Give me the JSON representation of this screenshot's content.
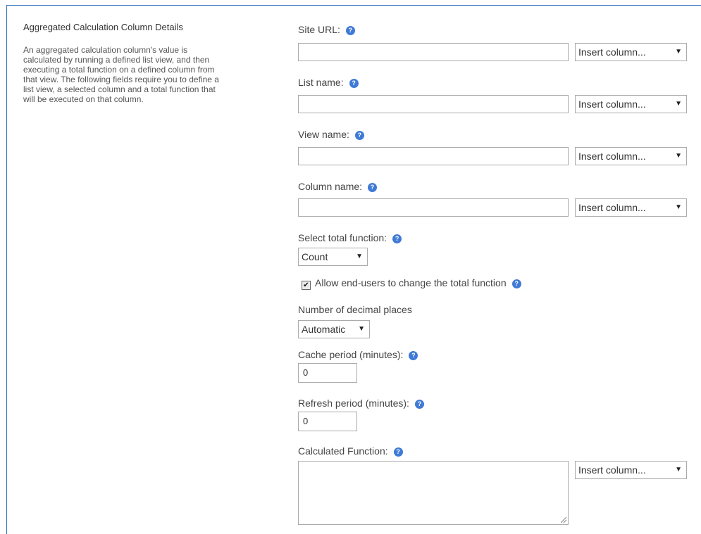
{
  "section": {
    "title": "Aggregated Calculation Column Details",
    "description": "An aggregated calculation column's value is calculated by running a defined list view, and then executing a total function on a defined column from that view. The following fields require you to define a list view, a selected column and a total function that will be executed on that column."
  },
  "icons": {
    "help": "question-help-icon",
    "dropdown": "triangle-down-icon",
    "checkbox": "check-icon",
    "resize": "resize-grip-icon"
  },
  "help_glyph": "?",
  "site_url": {
    "label": "Site URL:",
    "value": "",
    "insert": "Insert column..."
  },
  "list_name": {
    "label": "List name:",
    "value": "",
    "insert": "Insert column..."
  },
  "view_name": {
    "label": "View name:",
    "value": "",
    "insert": "Insert column..."
  },
  "column_name": {
    "label": "Column name:",
    "value": "",
    "insert": "Insert column..."
  },
  "total_function": {
    "label": "Select total function:",
    "selected": "Count"
  },
  "allow_change": {
    "label": "Allow end-users to change the total function",
    "checked": true,
    "mark": "✔"
  },
  "decimal_places": {
    "label": "Number of decimal places",
    "selected": "Automatic"
  },
  "cache_period": {
    "label": "Cache period (minutes):",
    "value": "0"
  },
  "refresh_period": {
    "label": "Refresh period (minutes):",
    "value": "0"
  },
  "calculated_function": {
    "label": "Calculated Function:",
    "value": "",
    "insert": "Insert column..."
  },
  "arrow_glyph": "▼",
  "colors": {
    "accent": "#2f6fb7",
    "help_icon": "#3f7ad6",
    "border": "#ababab"
  }
}
